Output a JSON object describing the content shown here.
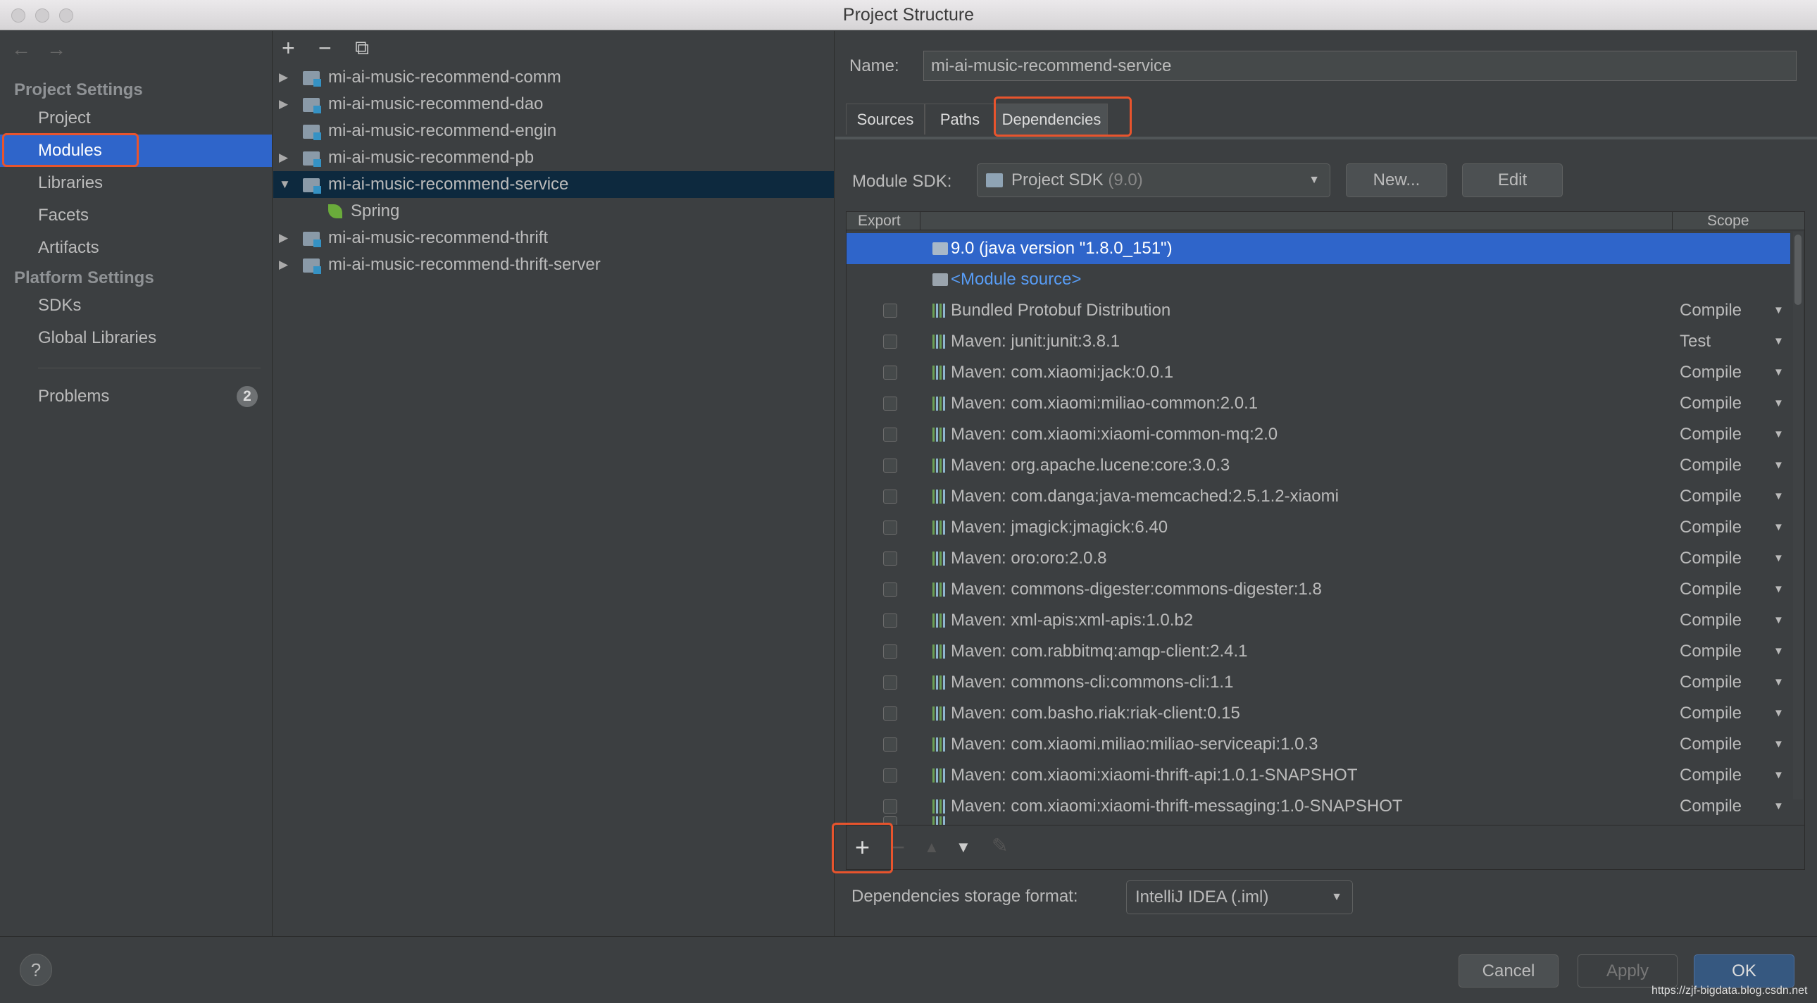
{
  "window": {
    "title": "Project Structure"
  },
  "sidebar": {
    "back": "←",
    "forward": "→",
    "project_settings": "Project Settings",
    "items_ps": [
      "Project",
      "Modules",
      "Libraries",
      "Facets",
      "Artifacts"
    ],
    "platform_settings": "Platform Settings",
    "items_plat": [
      "SDKs",
      "Global Libraries"
    ],
    "problems": "Problems",
    "problems_count": "2",
    "selected": "Modules"
  },
  "tree": {
    "add": "+",
    "remove": "−",
    "copy": "⧉",
    "modules": [
      {
        "label": "mi-ai-music-recommend-comm",
        "expander": "▶",
        "type": "module"
      },
      {
        "label": "mi-ai-music-recommend-dao",
        "expander": "▶",
        "type": "module"
      },
      {
        "label": "mi-ai-music-recommend-engin",
        "expander": "",
        "type": "module"
      },
      {
        "label": "mi-ai-music-recommend-pb",
        "expander": "▶",
        "type": "module"
      },
      {
        "label": "mi-ai-music-recommend-service",
        "expander": "▼",
        "type": "module",
        "selected": true
      },
      {
        "label": "Spring",
        "expander": "",
        "type": "spring"
      },
      {
        "label": "mi-ai-music-recommend-thrift",
        "expander": "▶",
        "type": "module"
      },
      {
        "label": "mi-ai-music-recommend-thrift-server",
        "expander": "▶",
        "type": "module"
      }
    ]
  },
  "main": {
    "name_label": "Name:",
    "name_value": "mi-ai-music-recommend-service",
    "tabs": [
      "Sources",
      "Paths",
      "Dependencies"
    ],
    "active_tab": "Dependencies",
    "sdk_label": "Module SDK:",
    "sdk_value": "Project SDK",
    "sdk_version": "(9.0)",
    "new_button": "New...",
    "edit_button": "Edit",
    "table": {
      "col_export": "Export",
      "col_scope": "Scope",
      "rows": [
        {
          "name": "9.0 (java version \"1.8.0_151\")",
          "type": "sdk",
          "selected": true
        },
        {
          "name": "<Module source>",
          "type": "source"
        },
        {
          "name": "Bundled Protobuf Distribution",
          "scope": "Compile"
        },
        {
          "name": "Maven: junit:junit:3.8.1",
          "scope": "Test"
        },
        {
          "name": "Maven: com.xiaomi:jack:0.0.1",
          "scope": "Compile"
        },
        {
          "name": "Maven: com.xiaomi:miliao-common:2.0.1",
          "scope": "Compile"
        },
        {
          "name": "Maven: com.xiaomi:xiaomi-common-mq:2.0",
          "scope": "Compile"
        },
        {
          "name": "Maven: org.apache.lucene:core:3.0.3",
          "scope": "Compile"
        },
        {
          "name": "Maven: com.danga:java-memcached:2.5.1.2-xiaomi",
          "scope": "Compile"
        },
        {
          "name": "Maven: jmagick:jmagick:6.40",
          "scope": "Compile"
        },
        {
          "name": "Maven: oro:oro:2.0.8",
          "scope": "Compile"
        },
        {
          "name": "Maven: commons-digester:commons-digester:1.8",
          "scope": "Compile"
        },
        {
          "name": "Maven: xml-apis:xml-apis:1.0.b2",
          "scope": "Compile"
        },
        {
          "name": "Maven: com.rabbitmq:amqp-client:2.4.1",
          "scope": "Compile"
        },
        {
          "name": "Maven: commons-cli:commons-cli:1.1",
          "scope": "Compile"
        },
        {
          "name": "Maven: com.basho.riak:riak-client:0.15",
          "scope": "Compile"
        },
        {
          "name": "Maven: com.xiaomi.miliao:miliao-serviceapi:1.0.3",
          "scope": "Compile"
        },
        {
          "name": "Maven: com.xiaomi:xiaomi-thrift-api:1.0.1-SNAPSHOT",
          "scope": "Compile"
        },
        {
          "name": "Maven: com.xiaomi:xiaomi-thrift-messaging:1.0-SNAPSHOT",
          "scope": "Compile"
        }
      ]
    },
    "toolbar": {
      "add": "+",
      "remove": "−",
      "up": "▲",
      "down": "▼",
      "edit": "✎"
    },
    "storage_label": "Dependencies storage format:",
    "storage_value": "IntelliJ IDEA (.iml)"
  },
  "footer": {
    "help": "?",
    "cancel": "Cancel",
    "apply": "Apply",
    "ok": "OK",
    "watermark": "https://zjf-bigdata.blog.csdn.net"
  },
  "colors": {
    "selection": "#2f65ca",
    "tree_selection": "#0d293e",
    "highlight": "#e8542d",
    "link": "#589df6"
  }
}
